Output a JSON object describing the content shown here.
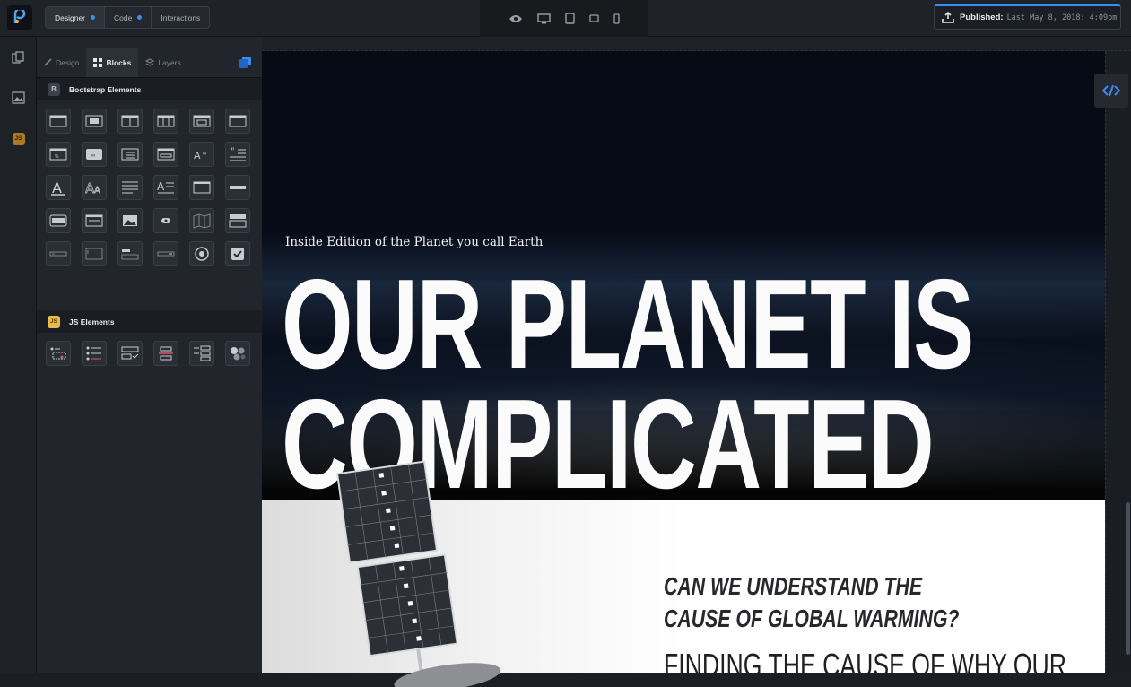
{
  "topbar": {
    "modes": [
      {
        "label": "Designer",
        "active": true,
        "dot": true
      },
      {
        "label": "Code",
        "active": false,
        "dot": true
      },
      {
        "label": "Interactions",
        "active": false,
        "dot": false
      }
    ],
    "devices": [
      "eye-icon",
      "desktop-icon",
      "tablet-icon",
      "tablet-landscape-icon",
      "phone-icon"
    ],
    "publish": {
      "label": "Published:",
      "date": "Last May 8, 2018: 4:09pm"
    }
  },
  "panel": {
    "tabs": [
      {
        "label": "Design",
        "icon": "brush-icon",
        "active": false
      },
      {
        "label": "Blocks",
        "icon": "blocks-icon",
        "active": true
      },
      {
        "label": "Layers",
        "icon": "layers-icon",
        "active": false
      }
    ],
    "bootstrap": {
      "title": "Bootstrap Elements",
      "badge": "B"
    },
    "js": {
      "title": "JS Elements",
      "badge": "JS"
    }
  },
  "rail": {
    "js_label": "JS"
  },
  "canvas": {
    "eyebrow": "Inside Edition of the Planet you call Earth",
    "headline_line1": "OUR PLANET IS",
    "headline_line2": "COMPLICATED",
    "question": "CAN WE UNDERSTAND THE CAUSE OF GLOBAL WARMING?",
    "finding": "FINDING THE CAUSE OF WHY OUR"
  },
  "colors": {
    "accent": "#3d8bef",
    "js_badge": "#e9b94a",
    "panel_bg": "#22262c"
  }
}
